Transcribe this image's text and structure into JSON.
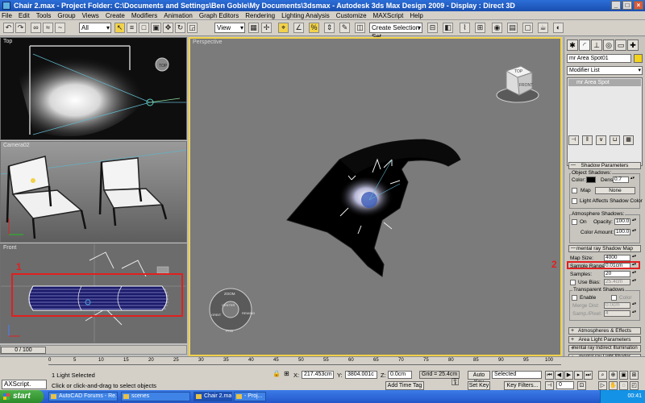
{
  "window": {
    "title": "Chair 2.max    - Project Folder: C:\\Documents and Settings\\Ben Goble\\My Documents\\3dsmax    - Autodesk 3ds Max Design 2009    - Display : Direct 3D"
  },
  "menu": [
    "File",
    "Edit",
    "Tools",
    "Group",
    "Views",
    "Create",
    "Modifiers",
    "Animation",
    "Graph Editors",
    "Rendering",
    "Lighting Analysis",
    "Customize",
    "MAXScript",
    "Help"
  ],
  "toolbar": {
    "selection_filter": "All",
    "reference_coord": "View",
    "named_selection": "Create Selection Set"
  },
  "viewports": {
    "top": "Top",
    "camera": "Camera02",
    "front": "Front",
    "perspective": "Perspective"
  },
  "annotations": {
    "one": "1",
    "two": "2"
  },
  "timeline": {
    "frame": "0 / 100"
  },
  "command_panel": {
    "object_name": "mr Area Spot01",
    "modifier_list": "Modifier List",
    "stack_item": "mr Area Spot",
    "shadow_params": {
      "header": "Shadow Parameters",
      "object_shadows": "Object Shadows:",
      "color_label": "Color:",
      "dens_label": "Dens.",
      "dens_value": "0.7",
      "map_label": "Map",
      "map_button": "None",
      "light_affects": "Light Affects Shadow Color",
      "atmo_title": "Atmosphere Shadows:",
      "on_label": "On",
      "opacity_label": "Opacity:",
      "opacity_value": "100.0",
      "color_amount_label": "Color Amount:",
      "color_amount_value": "100.0"
    },
    "shadow_map": {
      "header": "mental ray Shadow Map",
      "map_size_label": "Map Size:",
      "map_size_value": "4000",
      "sample_range_label": "Sample Range:",
      "sample_range_value": "0.01cm",
      "samples_label": "Samples:",
      "samples_value": "20",
      "use_bias_label": "Use Bias:",
      "use_bias_value": "25.4cm",
      "transparent_title": "Transparent Shadows",
      "enable_label": "Enable",
      "color_label": "Color",
      "merge_dist_label": "Merge Dist:",
      "merge_dist_value": "0.0cm",
      "samp_pixel_label": "Samp./Pixel:",
      "samp_pixel_value": "4"
    },
    "closed_rollouts": [
      "Atmospheres & Effects",
      "Area Light Parameters",
      "mental ray Indirect Illumination",
      "mental ray Light Shader"
    ]
  },
  "status": {
    "maxscript": "AXScript.",
    "selection": "1 Light Selected",
    "prompt": "Click or click-and-drag to select objects",
    "x_label": "X:",
    "x_value": "217.453cm",
    "y_label": "Y:",
    "y_value": "3804.001c",
    "z_label": "Z:",
    "z_value": "0.0cm",
    "grid": "Grid = 25.4cm",
    "auto_key": "Auto Key",
    "set_key": "Set Key",
    "key_mode": "Selected",
    "key_filters": "Key Filters...",
    "add_time_tag": "Add Time Tag",
    "frame_field": "0",
    "ruler_ticks": [
      "5",
      "10",
      "15",
      "20",
      "25",
      "30",
      "35",
      "40",
      "45",
      "50",
      "55",
      "60",
      "65",
      "70",
      "75",
      "80",
      "85",
      "90",
      "95",
      "100"
    ]
  },
  "taskbar": {
    "start": "start",
    "tasks": [
      "AutoCAD Forums - Re...",
      "scenes",
      "Chair 2.max",
      "- Proj..."
    ],
    "clock": "00:41"
  }
}
